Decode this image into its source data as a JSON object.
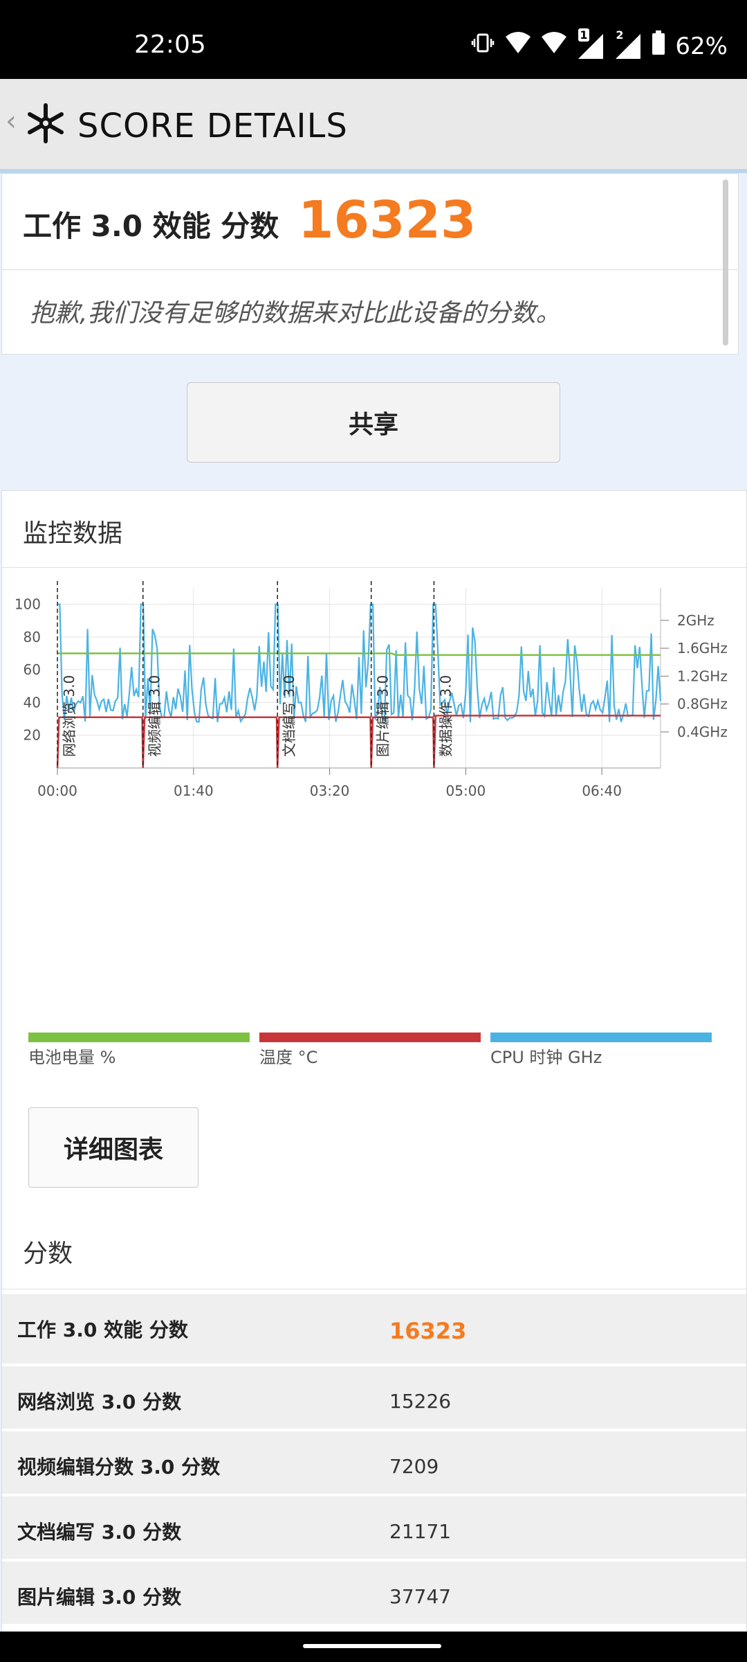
{
  "status": {
    "time": "22:05",
    "battery": "62%",
    "sim1": "1",
    "sim2": "2"
  },
  "appbar": {
    "back": "‹",
    "title": "SCORE DETAILS"
  },
  "score_card": {
    "title": "工作 3.0 效能 分数",
    "score": "16323",
    "note": "抱歉,我们没有足够的数据来对比此设备的分数。"
  },
  "share_button": "共享",
  "monitor": {
    "title": "监控数据",
    "legend": [
      "电池电量 %",
      "温度 °C",
      "CPU 时钟 GHz"
    ],
    "detail_button": "详细图表"
  },
  "colors": {
    "battery": "#7dc142",
    "temperature": "#c8363a",
    "cpu": "#4bb3e3",
    "accent": "#f47b20"
  },
  "chart_data": {
    "type": "line",
    "x_tick_labels": [
      "00:00",
      "01:40",
      "03:20",
      "05:00",
      "06:40"
    ],
    "y_left_ticks": [
      "20",
      "40",
      "60",
      "80",
      "100"
    ],
    "y_right_ticks": [
      "0.4GHz",
      "0.8GHz",
      "1.2GHz",
      "1.6GHz",
      "2GHz"
    ],
    "ylim_left": [
      0,
      110
    ],
    "xlim": [
      0,
      7.4
    ],
    "segments": [
      {
        "label": "网络浏览 3.0",
        "start": 0.0
      },
      {
        "label": "视频编辑 3.0",
        "start": 1.05
      },
      {
        "label": "文档编写 3.0",
        "start": 2.7
      },
      {
        "label": "图片编辑 3.0",
        "start": 3.85
      },
      {
        "label": "数据操作 3.0",
        "start": 4.62
      }
    ],
    "series": [
      {
        "name": "电池电量 %",
        "x": [
          0,
          4.1,
          4.15,
          7.4
        ],
        "values": [
          70,
          70,
          69,
          69
        ]
      },
      {
        "name": "温度 °C",
        "x": [
          0,
          4.62,
          4.65,
          7.4
        ],
        "values": [
          31,
          31,
          32,
          32
        ]
      },
      {
        "name": "CPU 时钟 GHz",
        "x": [],
        "values": []
      }
    ]
  },
  "scores": {
    "title": "分数",
    "rows": [
      {
        "name": "工作 3.0 效能 分数",
        "value": "16323"
      },
      {
        "name": "网络浏览 3.0 分数",
        "value": "15226"
      },
      {
        "name": "视频编辑分数 3.0 分数",
        "value": "7209"
      },
      {
        "name": "文档编写 3.0 分数",
        "value": "21171"
      },
      {
        "name": "图片编辑 3.0 分数",
        "value": "37747"
      }
    ]
  }
}
